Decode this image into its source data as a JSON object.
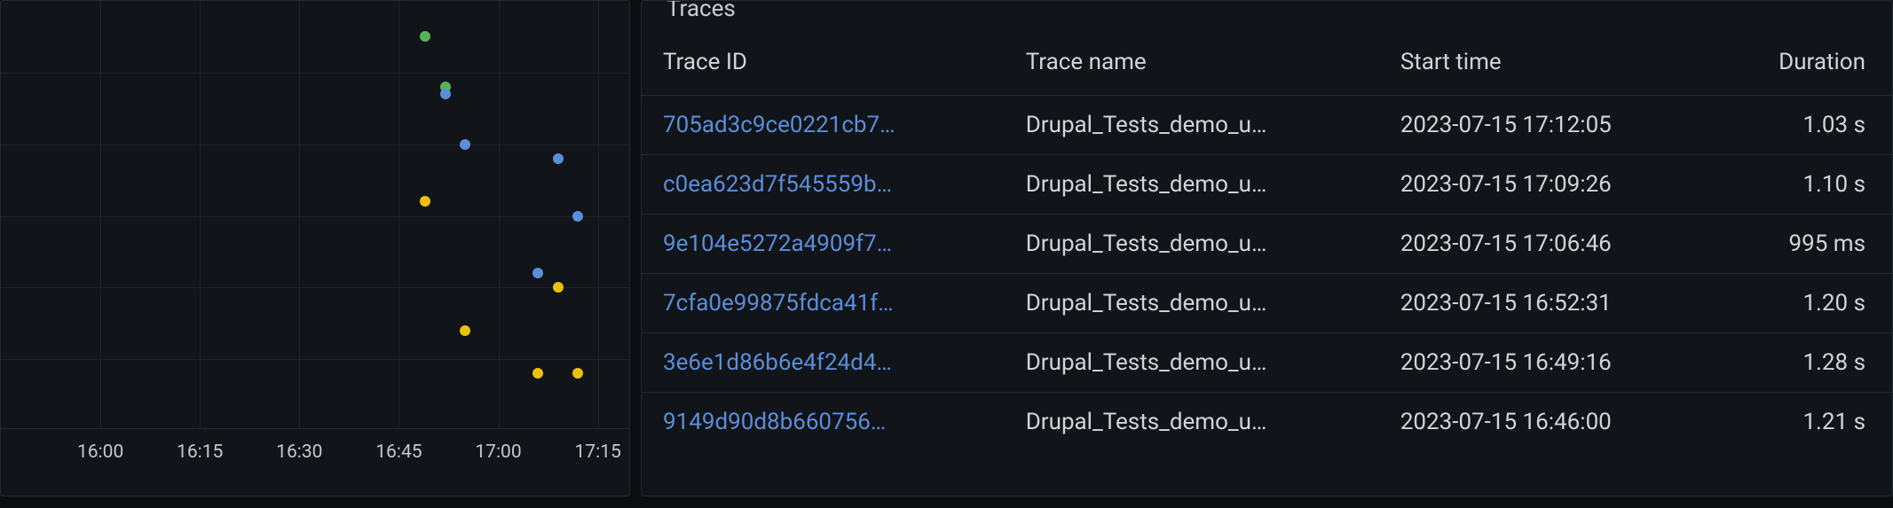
{
  "traces": {
    "title": "Traces",
    "columns": {
      "trace_id": "Trace ID",
      "trace_name": "Trace name",
      "start_time": "Start time",
      "duration": "Duration"
    },
    "rows": [
      {
        "id": "705ad3c9ce0221cb7…",
        "name": "Drupal_Tests_demo_u…",
        "start": "2023-07-15 17:12:05",
        "duration": "1.03 s"
      },
      {
        "id": "c0ea623d7f545559b…",
        "name": "Drupal_Tests_demo_u…",
        "start": "2023-07-15 17:09:26",
        "duration": "1.10 s"
      },
      {
        "id": "9e104e5272a4909f7…",
        "name": "Drupal_Tests_demo_u…",
        "start": "2023-07-15 17:06:46",
        "duration": "995 ms"
      },
      {
        "id": "7cfa0e99875fdca41f…",
        "name": "Drupal_Tests_demo_u…",
        "start": "2023-07-15 16:52:31",
        "duration": "1.20 s"
      },
      {
        "id": "3e6e1d86b6e4f24d4…",
        "name": "Drupal_Tests_demo_u…",
        "start": "2023-07-15 16:49:16",
        "duration": "1.28 s"
      },
      {
        "id": "9149d90d8b660756…",
        "name": "Drupal_Tests_demo_u…",
        "start": "2023-07-15 16:46:00",
        "duration": "1.21 s"
      }
    ]
  },
  "chart_data": {
    "type": "scatter",
    "title": "",
    "xlabel": "",
    "ylabel": "",
    "x_ticks": [
      "16:00",
      "16:15",
      "16:30",
      "16:45",
      "17:00",
      "17:15"
    ],
    "x_range": [
      "15:45",
      "17:20"
    ],
    "y_range": [
      0.9,
      1.5
    ],
    "series": [
      {
        "name": "green",
        "color": "#56b35a",
        "points": [
          {
            "x": "16:49",
            "y": 1.45
          },
          {
            "x": "16:52",
            "y": 1.38
          }
        ]
      },
      {
        "name": "blue",
        "color": "#5a8edb",
        "points": [
          {
            "x": "16:52",
            "y": 1.37
          },
          {
            "x": "16:55",
            "y": 1.3
          },
          {
            "x": "17:09",
            "y": 1.28
          },
          {
            "x": "17:12",
            "y": 1.2
          },
          {
            "x": "17:06",
            "y": 1.12
          }
        ]
      },
      {
        "name": "yellow",
        "color": "#ecc109",
        "points": [
          {
            "x": "16:49",
            "y": 1.22
          },
          {
            "x": "16:55",
            "y": 1.04
          },
          {
            "x": "17:09",
            "y": 1.1
          },
          {
            "x": "17:06",
            "y": 0.98
          },
          {
            "x": "17:12",
            "y": 0.98
          }
        ]
      }
    ]
  }
}
